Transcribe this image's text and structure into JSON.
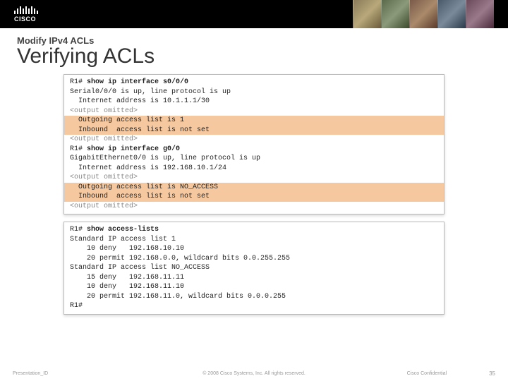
{
  "logo_text": "CISCO",
  "subtitle": "Modify IPv4 ACLs",
  "title": "Verifying ACLs",
  "box1": {
    "l1_prompt": "R1# ",
    "l1_cmd": "show ip interface s0/0/0",
    "l2": "Serial0/0/0 is up, line protocol is up",
    "l3": "  Internet address is 10.1.1.1/30",
    "l4": "<output omitted>",
    "l5": "  Outgoing access list is 1",
    "l6": "  Inbound  access list is not set",
    "l7": "<output omitted>",
    "l8": "",
    "l9_prompt": "R1# ",
    "l9_cmd": "show ip interface g0/0",
    "l10": "GigabitEthernet0/0 is up, line protocol is up",
    "l11": "  Internet address is 192.168.10.1/24",
    "l12": "<output omitted>",
    "l13": "  Outgoing access list is NO_ACCESS",
    "l14": "  Inbound  access list is not set",
    "l15": "<output omitted>"
  },
  "box2": {
    "l1_prompt": "R1# ",
    "l1_cmd": "show access-lists",
    "l2": "Standard IP access list 1",
    "l3": "    10 deny   192.168.10.10",
    "l4": "    20 permit 192.168.0.0, wildcard bits 0.0.255.255",
    "l5": "Standard IP access list NO_ACCESS",
    "l6": "    15 deny   192.168.11.11",
    "l7": "    10 deny   192.168.11.10",
    "l8": "    20 permit 192.168.11.0, wildcard bits 0.0.0.255",
    "l9": "R1#"
  },
  "footer": {
    "left": "Presentation_ID",
    "center": "© 2008 Cisco Systems, Inc. All rights reserved.",
    "confidential": "Cisco Confidential",
    "slide": "35"
  }
}
